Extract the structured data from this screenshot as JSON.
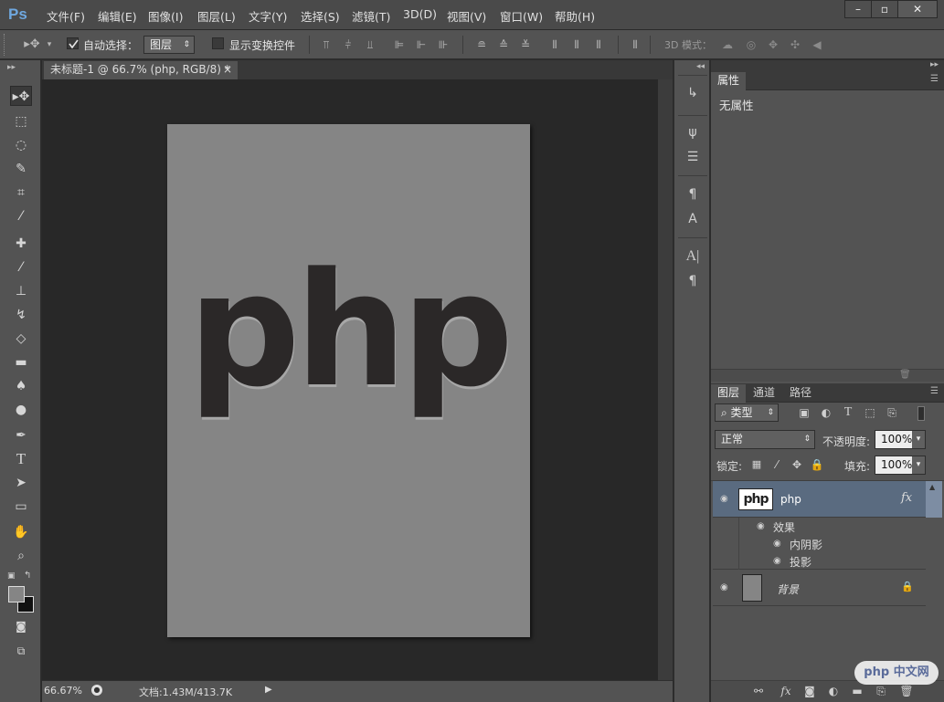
{
  "app": {
    "logo": "Ps"
  },
  "menu": [
    "文件(F)",
    "编辑(E)",
    "图像(I)",
    "图层(L)",
    "文字(Y)",
    "选择(S)",
    "滤镜(T)",
    "3D(D)",
    "视图(V)",
    "窗口(W)",
    "帮助(H)"
  ],
  "window_controls": {
    "minimize": "–",
    "maximize": "▫",
    "close": "✕"
  },
  "options": {
    "auto_select_label": "自动选择：",
    "auto_select_checked": true,
    "target_value": "图层",
    "show_transform_label": "显示变换控件",
    "show_transform_checked": false,
    "mode_3d_label": "3D 模式："
  },
  "document": {
    "tab_title": "未标题-1 @ 66.7% (php, RGB/8) *",
    "close": "×",
    "canvas_text": "php",
    "canvas_color": "#858585",
    "text_color": "#2b2828"
  },
  "status": {
    "zoom": "66.67%",
    "doc_info": "文档:1.43M/413.7K"
  },
  "properties": {
    "tab": "属性",
    "content": "无属性"
  },
  "layers_panel": {
    "tabs": [
      "图层",
      "通道",
      "路径"
    ],
    "filter_kind": "类型",
    "blend_mode": "正常",
    "opacity_label": "不透明度:",
    "opacity_value": "100%",
    "lock_label": "锁定:",
    "fill_label": "填充:",
    "fill_value": "100%",
    "layers": [
      {
        "name": "php",
        "thumb": "php",
        "fx": "fx",
        "effects_label": "效果",
        "effects": [
          "内阴影",
          "投影"
        ],
        "selected": true
      },
      {
        "name": "背景",
        "locked": true,
        "selected": false
      }
    ]
  },
  "colors": {
    "accent": "#6fa8e0",
    "selected_layer": "#5a6b80",
    "workspace": "#282828",
    "panel": "#535353"
  },
  "watermark": "php 中文网"
}
